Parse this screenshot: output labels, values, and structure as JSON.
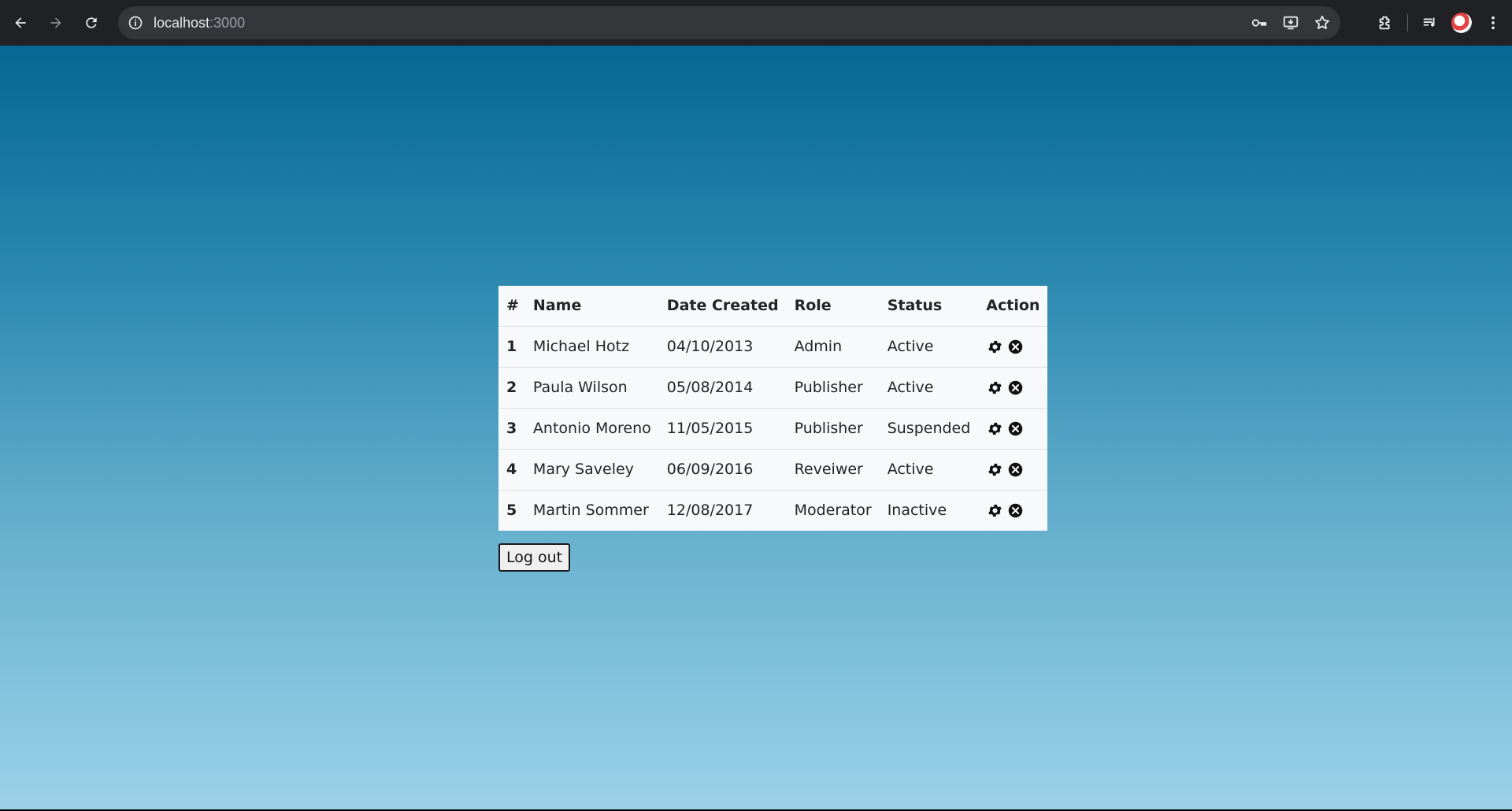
{
  "browser": {
    "url_host": "localhost",
    "url_port": ":3000"
  },
  "table": {
    "headers": [
      "#",
      "Name",
      "Date Created",
      "Role",
      "Status",
      "Action"
    ],
    "rows": [
      {
        "num": "1",
        "name": "Michael Hotz",
        "date": "04/10/2013",
        "role": "Admin",
        "status": "Active"
      },
      {
        "num": "2",
        "name": "Paula Wilson",
        "date": "05/08/2014",
        "role": "Publisher",
        "status": "Active"
      },
      {
        "num": "3",
        "name": "Antonio Moreno",
        "date": "11/05/2015",
        "role": "Publisher",
        "status": "Suspended"
      },
      {
        "num": "4",
        "name": "Mary Saveley",
        "date": "06/09/2016",
        "role": "Reveiwer",
        "status": "Active"
      },
      {
        "num": "5",
        "name": "Martin Sommer",
        "date": "12/08/2017",
        "role": "Moderator",
        "status": "Inactive"
      }
    ],
    "action_icons": [
      "gear-icon",
      "close-circle-icon"
    ]
  },
  "logout_label": "Log out",
  "colors": {
    "chrome_bg": "#202124",
    "omnibox_bg": "#35363a",
    "gradient_top": "#056893",
    "gradient_bottom": "#9bd1e8",
    "table_bg": "#f8f9fa"
  }
}
